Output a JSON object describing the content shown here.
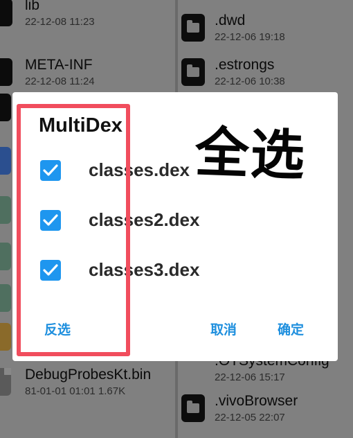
{
  "left_column": [
    {
      "name": "lib",
      "meta": "22-12-08 11:23",
      "icon": "folder-icon"
    },
    {
      "name": "META-INF",
      "meta": "22-12-08 11:24",
      "icon": "folder-icon"
    },
    {
      "name": "DebugProbesKt.bin",
      "meta": "81-01-01 01:01  1.67K",
      "icon": "document-icon"
    }
  ],
  "right_column": [
    {
      "name": ".dwd",
      "meta": "22-12-06 19:18",
      "icon": "folder-icon"
    },
    {
      "name": ".estrongs",
      "meta": "22-12-06 10:38",
      "icon": "folder-icon"
    },
    {
      "name": ".OTSystemConfig",
      "meta": "22-12-06 15:17",
      "icon": "folder-icon"
    },
    {
      "name": ".vivoBrowser",
      "meta": "22-12-05 22:07",
      "icon": "folder-icon"
    }
  ],
  "dialog": {
    "title": "MultiDex",
    "items": [
      {
        "label": "classes.dex",
        "checked": true
      },
      {
        "label": "classes2.dex",
        "checked": true
      },
      {
        "label": "classes3.dex",
        "checked": true
      }
    ],
    "invert_label": "反选",
    "cancel_label": "取消",
    "ok_label": "确定"
  },
  "annotation": {
    "overlay_text": "全选",
    "box_color": "#f14d5d"
  },
  "colors": {
    "accent": "#1e96ef",
    "button_text": "#1e8fde"
  }
}
